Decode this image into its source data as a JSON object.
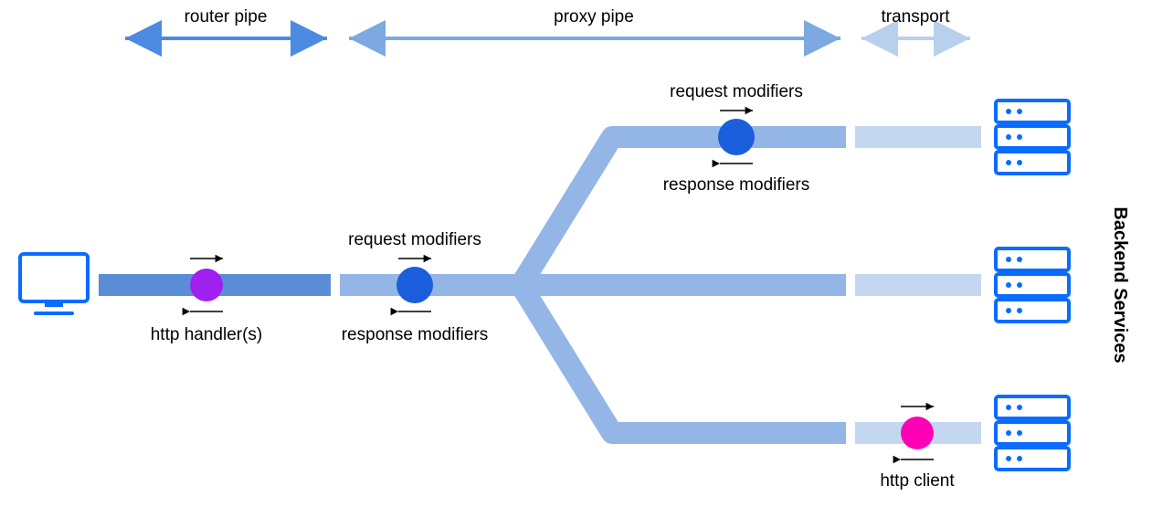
{
  "sections": {
    "router_label": "router pipe",
    "proxy_label": "proxy pipe",
    "transport_label": "transport"
  },
  "nodes": {
    "http_handlers": "http handler(s)",
    "proxy_request_modifiers": "request modifiers",
    "proxy_response_modifiers": "response modifiers",
    "branch_request_modifiers": "request modifiers",
    "branch_response_modifiers": "response modifiers",
    "http_client": "http client"
  },
  "backend_label": "Backend Services",
  "colors": {
    "router_pipe": "#5b8dd6",
    "proxy_pipe": "#94b6e6",
    "transport_pipe": "#c4d7f0",
    "router_dot": "#a020f0",
    "proxy_dot": "#1a5edb",
    "client_dot": "#ff00b6",
    "server_stroke": "#0a6cff",
    "section_arrow_router": "#4d8be0",
    "section_arrow_proxy": "#7ba9e0",
    "section_arrow_transport": "#b8d0ee"
  }
}
